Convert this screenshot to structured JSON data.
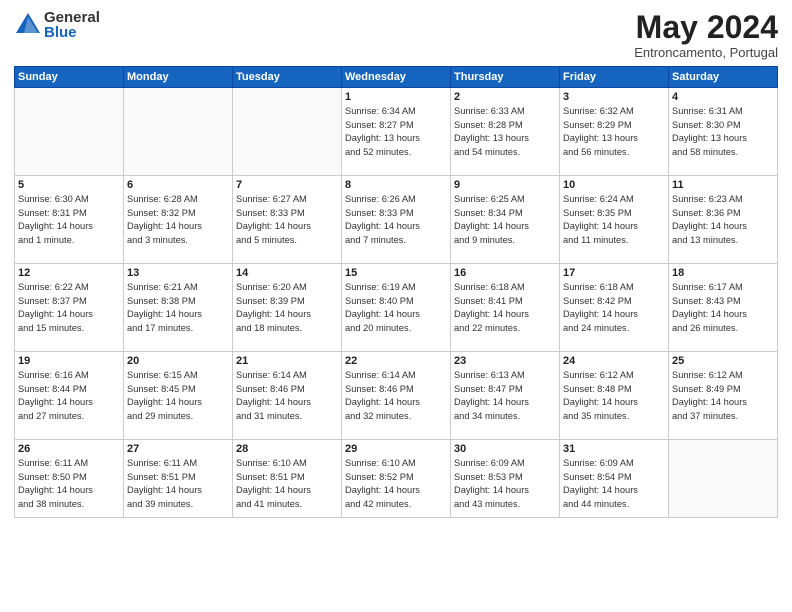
{
  "logo": {
    "general": "General",
    "blue": "Blue"
  },
  "title": "May 2024",
  "location": "Entroncamento, Portugal",
  "days_of_week": [
    "Sunday",
    "Monday",
    "Tuesday",
    "Wednesday",
    "Thursday",
    "Friday",
    "Saturday"
  ],
  "weeks": [
    [
      {
        "num": "",
        "info": ""
      },
      {
        "num": "",
        "info": ""
      },
      {
        "num": "",
        "info": ""
      },
      {
        "num": "1",
        "info": "Sunrise: 6:34 AM\nSunset: 8:27 PM\nDaylight: 13 hours\nand 52 minutes."
      },
      {
        "num": "2",
        "info": "Sunrise: 6:33 AM\nSunset: 8:28 PM\nDaylight: 13 hours\nand 54 minutes."
      },
      {
        "num": "3",
        "info": "Sunrise: 6:32 AM\nSunset: 8:29 PM\nDaylight: 13 hours\nand 56 minutes."
      },
      {
        "num": "4",
        "info": "Sunrise: 6:31 AM\nSunset: 8:30 PM\nDaylight: 13 hours\nand 58 minutes."
      }
    ],
    [
      {
        "num": "5",
        "info": "Sunrise: 6:30 AM\nSunset: 8:31 PM\nDaylight: 14 hours\nand 1 minute."
      },
      {
        "num": "6",
        "info": "Sunrise: 6:28 AM\nSunset: 8:32 PM\nDaylight: 14 hours\nand 3 minutes."
      },
      {
        "num": "7",
        "info": "Sunrise: 6:27 AM\nSunset: 8:33 PM\nDaylight: 14 hours\nand 5 minutes."
      },
      {
        "num": "8",
        "info": "Sunrise: 6:26 AM\nSunset: 8:33 PM\nDaylight: 14 hours\nand 7 minutes."
      },
      {
        "num": "9",
        "info": "Sunrise: 6:25 AM\nSunset: 8:34 PM\nDaylight: 14 hours\nand 9 minutes."
      },
      {
        "num": "10",
        "info": "Sunrise: 6:24 AM\nSunset: 8:35 PM\nDaylight: 14 hours\nand 11 minutes."
      },
      {
        "num": "11",
        "info": "Sunrise: 6:23 AM\nSunset: 8:36 PM\nDaylight: 14 hours\nand 13 minutes."
      }
    ],
    [
      {
        "num": "12",
        "info": "Sunrise: 6:22 AM\nSunset: 8:37 PM\nDaylight: 14 hours\nand 15 minutes."
      },
      {
        "num": "13",
        "info": "Sunrise: 6:21 AM\nSunset: 8:38 PM\nDaylight: 14 hours\nand 17 minutes."
      },
      {
        "num": "14",
        "info": "Sunrise: 6:20 AM\nSunset: 8:39 PM\nDaylight: 14 hours\nand 18 minutes."
      },
      {
        "num": "15",
        "info": "Sunrise: 6:19 AM\nSunset: 8:40 PM\nDaylight: 14 hours\nand 20 minutes."
      },
      {
        "num": "16",
        "info": "Sunrise: 6:18 AM\nSunset: 8:41 PM\nDaylight: 14 hours\nand 22 minutes."
      },
      {
        "num": "17",
        "info": "Sunrise: 6:18 AM\nSunset: 8:42 PM\nDaylight: 14 hours\nand 24 minutes."
      },
      {
        "num": "18",
        "info": "Sunrise: 6:17 AM\nSunset: 8:43 PM\nDaylight: 14 hours\nand 26 minutes."
      }
    ],
    [
      {
        "num": "19",
        "info": "Sunrise: 6:16 AM\nSunset: 8:44 PM\nDaylight: 14 hours\nand 27 minutes."
      },
      {
        "num": "20",
        "info": "Sunrise: 6:15 AM\nSunset: 8:45 PM\nDaylight: 14 hours\nand 29 minutes."
      },
      {
        "num": "21",
        "info": "Sunrise: 6:14 AM\nSunset: 8:46 PM\nDaylight: 14 hours\nand 31 minutes."
      },
      {
        "num": "22",
        "info": "Sunrise: 6:14 AM\nSunset: 8:46 PM\nDaylight: 14 hours\nand 32 minutes."
      },
      {
        "num": "23",
        "info": "Sunrise: 6:13 AM\nSunset: 8:47 PM\nDaylight: 14 hours\nand 34 minutes."
      },
      {
        "num": "24",
        "info": "Sunrise: 6:12 AM\nSunset: 8:48 PM\nDaylight: 14 hours\nand 35 minutes."
      },
      {
        "num": "25",
        "info": "Sunrise: 6:12 AM\nSunset: 8:49 PM\nDaylight: 14 hours\nand 37 minutes."
      }
    ],
    [
      {
        "num": "26",
        "info": "Sunrise: 6:11 AM\nSunset: 8:50 PM\nDaylight: 14 hours\nand 38 minutes."
      },
      {
        "num": "27",
        "info": "Sunrise: 6:11 AM\nSunset: 8:51 PM\nDaylight: 14 hours\nand 39 minutes."
      },
      {
        "num": "28",
        "info": "Sunrise: 6:10 AM\nSunset: 8:51 PM\nDaylight: 14 hours\nand 41 minutes."
      },
      {
        "num": "29",
        "info": "Sunrise: 6:10 AM\nSunset: 8:52 PM\nDaylight: 14 hours\nand 42 minutes."
      },
      {
        "num": "30",
        "info": "Sunrise: 6:09 AM\nSunset: 8:53 PM\nDaylight: 14 hours\nand 43 minutes."
      },
      {
        "num": "31",
        "info": "Sunrise: 6:09 AM\nSunset: 8:54 PM\nDaylight: 14 hours\nand 44 minutes."
      },
      {
        "num": "",
        "info": ""
      }
    ]
  ]
}
